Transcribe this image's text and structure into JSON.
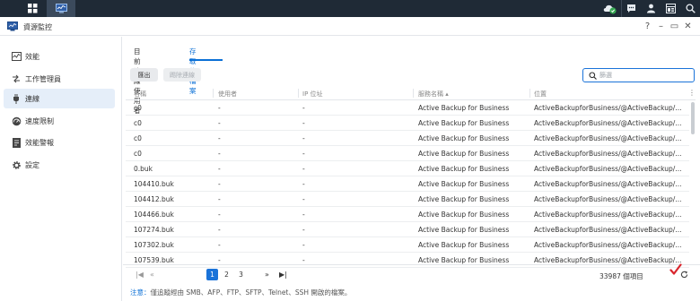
{
  "window": {
    "title": "資源監控",
    "controls": [
      "?",
      "–",
      "▭",
      "✕"
    ]
  },
  "sidebar": {
    "items": [
      {
        "label": "效能",
        "icon": "performance-icon"
      },
      {
        "label": "工作管理員",
        "icon": "task-manager-icon"
      },
      {
        "label": "連線",
        "icon": "connection-icon",
        "active": true
      },
      {
        "label": "速度限制",
        "icon": "speed-limit-icon"
      },
      {
        "label": "效能警報",
        "icon": "alert-icon"
      },
      {
        "label": "設定",
        "icon": "gear-icon"
      }
    ]
  },
  "tabs": [
    {
      "label": "目前連線使用者"
    },
    {
      "label": "存取的檔案",
      "active": true
    }
  ],
  "toolbar": {
    "export_label": "匯出",
    "disconnect_label": "踢除連線",
    "search_placeholder": "篩選"
  },
  "table": {
    "columns": [
      "名稱",
      "使用者",
      "IP 位址",
      "服務名稱 ▴",
      "位置"
    ],
    "rows": [
      [
        "c0",
        "-",
        "-",
        "Active Backup for Business",
        "ActiveBackupforBusiness/@ActiveBackup/..."
      ],
      [
        "c0",
        "-",
        "-",
        "Active Backup for Business",
        "ActiveBackupforBusiness/@ActiveBackup/..."
      ],
      [
        "c0",
        "-",
        "-",
        "Active Backup for Business",
        "ActiveBackupforBusiness/@ActiveBackup/..."
      ],
      [
        "c0",
        "-",
        "-",
        "Active Backup for Business",
        "ActiveBackupforBusiness/@ActiveBackup/..."
      ],
      [
        "0.buk",
        "-",
        "-",
        "Active Backup for Business",
        "ActiveBackupforBusiness/@ActiveBackup/..."
      ],
      [
        "104410.buk",
        "-",
        "-",
        "Active Backup for Business",
        "ActiveBackupforBusiness/@ActiveBackup/..."
      ],
      [
        "104412.buk",
        "-",
        "-",
        "Active Backup for Business",
        "ActiveBackupforBusiness/@ActiveBackup/..."
      ],
      [
        "104466.buk",
        "-",
        "-",
        "Active Backup for Business",
        "ActiveBackupforBusiness/@ActiveBackup/..."
      ],
      [
        "107274.buk",
        "-",
        "-",
        "Active Backup for Business",
        "ActiveBackupforBusiness/@ActiveBackup/..."
      ],
      [
        "107302.buk",
        "-",
        "-",
        "Active Backup for Business",
        "ActiveBackupforBusiness/@ActiveBackup/..."
      ],
      [
        "107539.buk",
        "-",
        "-",
        "Active Backup for Business",
        "ActiveBackupforBusiness/@ActiveBackup/..."
      ]
    ]
  },
  "pagination": {
    "first": "|◀",
    "prev": "«",
    "pages": [
      "1",
      "2",
      "3"
    ],
    "current": "1",
    "next": "»",
    "last": "▶|",
    "count_text": "33987 個項目"
  },
  "note": {
    "label": "注意：",
    "text": "僅追蹤經由 SMB、AFP、FTP、SFTP、Telnet、SSH 開啟的檔案。"
  },
  "colors": {
    "accent": "#1a73d9",
    "taskbar": "#1f2a36",
    "active_nav": "#e5eef9"
  }
}
